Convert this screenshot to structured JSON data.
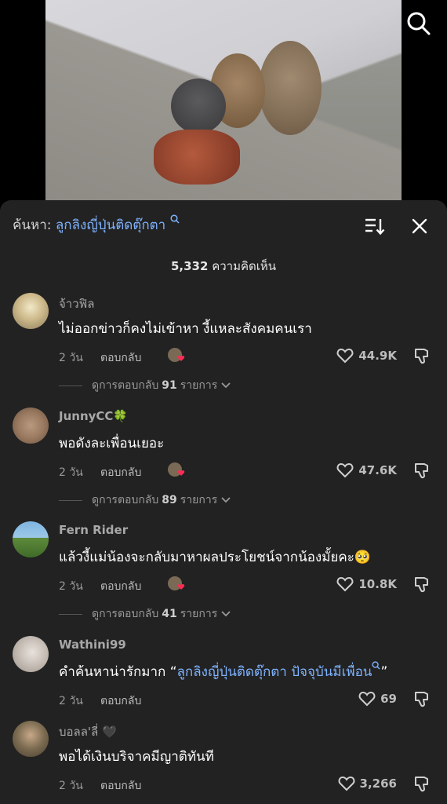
{
  "search_bar": {
    "label": "ค้นหา:",
    "query": "ลูกลิงญี่ปุ่นติดตุ๊กตา"
  },
  "comment_count": {
    "number": "5,332",
    "suffix": "ความคิดเห็น"
  },
  "comments": [
    {
      "username": "จ้าวฟิล",
      "text": "ไม่ออกข่าวก็คงไม่เข้าหา งี้แหละสังคมคนเรา",
      "time": "2 วัน",
      "reply_label": "ตอบกลับ",
      "likes": "44.9K",
      "view_replies_prefix": "ดูการตอบกลับ",
      "view_replies_count": "91",
      "view_replies_suffix": "รายการ"
    },
    {
      "username": "JunnyCC🍀",
      "text": "พอดังละเพื่อนเยอะ",
      "time": "2 วัน",
      "reply_label": "ตอบกลับ",
      "likes": "47.6K",
      "view_replies_prefix": "ดูการตอบกลับ",
      "view_replies_count": "89",
      "view_replies_suffix": "รายการ"
    },
    {
      "username": "Fern Rider",
      "text": "แล้วงี้แม่น้องจะกลับมาหาผลประโยชน์จากน้องมั้ยคะ🥺",
      "time": "2 วัน",
      "reply_label": "ตอบกลับ",
      "likes": "10.8K",
      "view_replies_prefix": "ดูการตอบกลับ",
      "view_replies_count": "41",
      "view_replies_suffix": "รายการ"
    },
    {
      "username": "Wathini99",
      "text_prefix": "คำค้นหาน่ารักมาก “",
      "text_link": "ลูกลิงญี่ปุ่นติดตุ๊กตา ปัจจุบันมีเพื่อน",
      "text_suffix": "”",
      "time": "2 วัน",
      "reply_label": "ตอบกลับ",
      "likes": "69"
    },
    {
      "username": "บอลล'ลี่ 🖤",
      "text": "พอได้เงินบริจาคมีญาติทันที",
      "time": "2 วัน",
      "reply_label": "ตอบกลับ",
      "likes": "3,266"
    }
  ],
  "icons": {
    "search": "search-icon",
    "sort": "sort-icon",
    "close": "close-icon",
    "like": "heart-icon",
    "dislike": "thumbs-down-icon",
    "expand": "chevron-down-icon",
    "query_search": "magnifier-small-icon"
  },
  "colors": {
    "sheet_bg": "#222222",
    "link": "#7fb3ff",
    "creator_heart": "#fe2c55"
  }
}
